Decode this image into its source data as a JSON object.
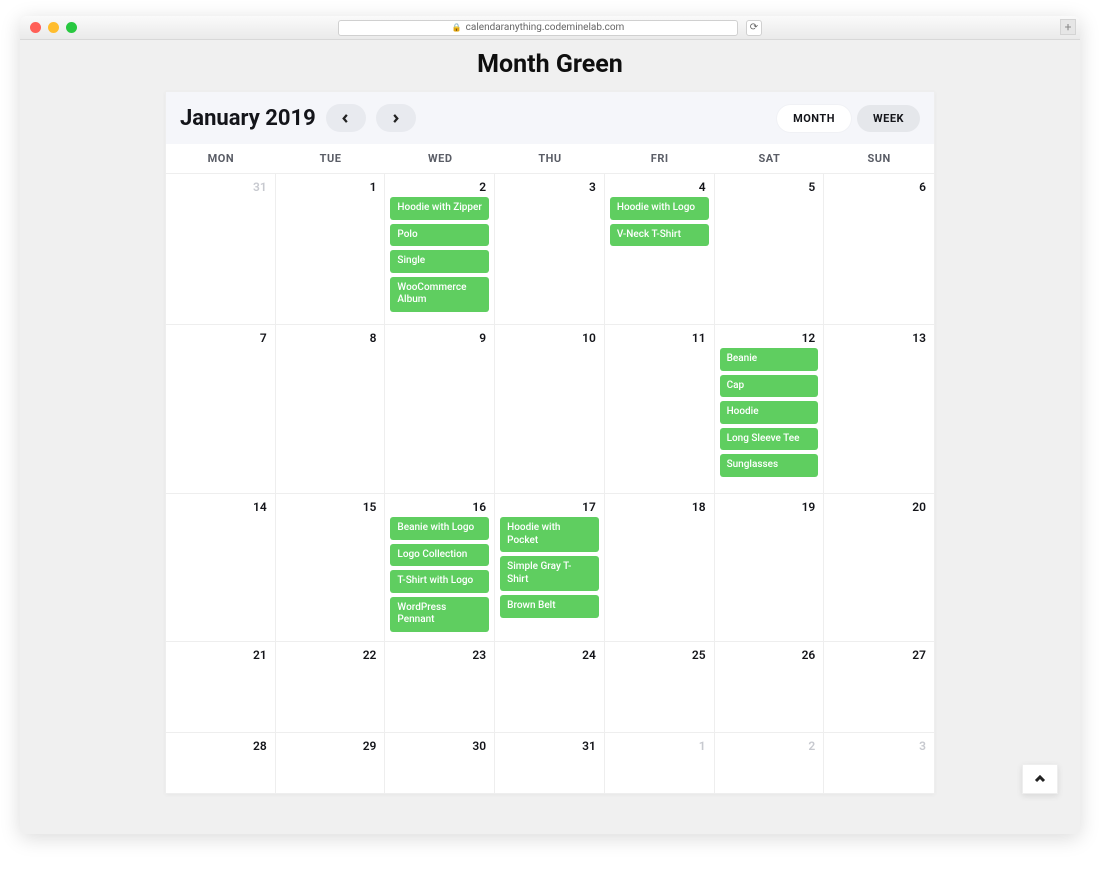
{
  "browser": {
    "url": "calendaranything.codeminelab.com"
  },
  "page": {
    "title": "Month Green"
  },
  "calendar": {
    "title": "January 2019",
    "views": {
      "month": "MONTH",
      "week": "WEEK",
      "active": "month"
    },
    "day_headers": [
      "MON",
      "TUE",
      "WED",
      "THU",
      "FRI",
      "SAT",
      "SUN"
    ],
    "event_color": "#5fce60",
    "cell_min_heights": [
      150,
      168,
      140,
      90,
      60
    ],
    "weeks": [
      [
        {
          "num": "31",
          "mute": true,
          "events": []
        },
        {
          "num": "1",
          "events": []
        },
        {
          "num": "2",
          "events": [
            "Hoodie with Zipper",
            "Polo",
            "Single",
            "WooCommerce Album"
          ]
        },
        {
          "num": "3",
          "events": []
        },
        {
          "num": "4",
          "events": [
            "Hoodie with Logo",
            "V-Neck T-Shirt"
          ]
        },
        {
          "num": "5",
          "events": []
        },
        {
          "num": "6",
          "events": []
        }
      ],
      [
        {
          "num": "7",
          "events": []
        },
        {
          "num": "8",
          "events": []
        },
        {
          "num": "9",
          "events": []
        },
        {
          "num": "10",
          "events": []
        },
        {
          "num": "11",
          "events": []
        },
        {
          "num": "12",
          "events": [
            "Beanie",
            "Cap",
            "Hoodie",
            "Long Sleeve Tee",
            "Sunglasses"
          ]
        },
        {
          "num": "13",
          "events": []
        }
      ],
      [
        {
          "num": "14",
          "events": []
        },
        {
          "num": "15",
          "events": []
        },
        {
          "num": "16",
          "events": [
            "Beanie with Logo",
            "Logo Collection",
            "T-Shirt with Logo",
            "WordPress Pennant"
          ]
        },
        {
          "num": "17",
          "events": [
            "Hoodie with Pocket",
            "Simple Gray T-Shirt",
            "Brown Belt"
          ]
        },
        {
          "num": "18",
          "events": []
        },
        {
          "num": "19",
          "events": []
        },
        {
          "num": "20",
          "events": []
        }
      ],
      [
        {
          "num": "21",
          "events": []
        },
        {
          "num": "22",
          "events": []
        },
        {
          "num": "23",
          "events": []
        },
        {
          "num": "24",
          "events": []
        },
        {
          "num": "25",
          "events": []
        },
        {
          "num": "26",
          "events": []
        },
        {
          "num": "27",
          "events": []
        }
      ],
      [
        {
          "num": "28",
          "events": []
        },
        {
          "num": "29",
          "events": []
        },
        {
          "num": "30",
          "events": []
        },
        {
          "num": "31",
          "events": []
        },
        {
          "num": "1",
          "mute": true,
          "events": []
        },
        {
          "num": "2",
          "mute": true,
          "events": []
        },
        {
          "num": "3",
          "mute": true,
          "events": []
        }
      ]
    ]
  }
}
